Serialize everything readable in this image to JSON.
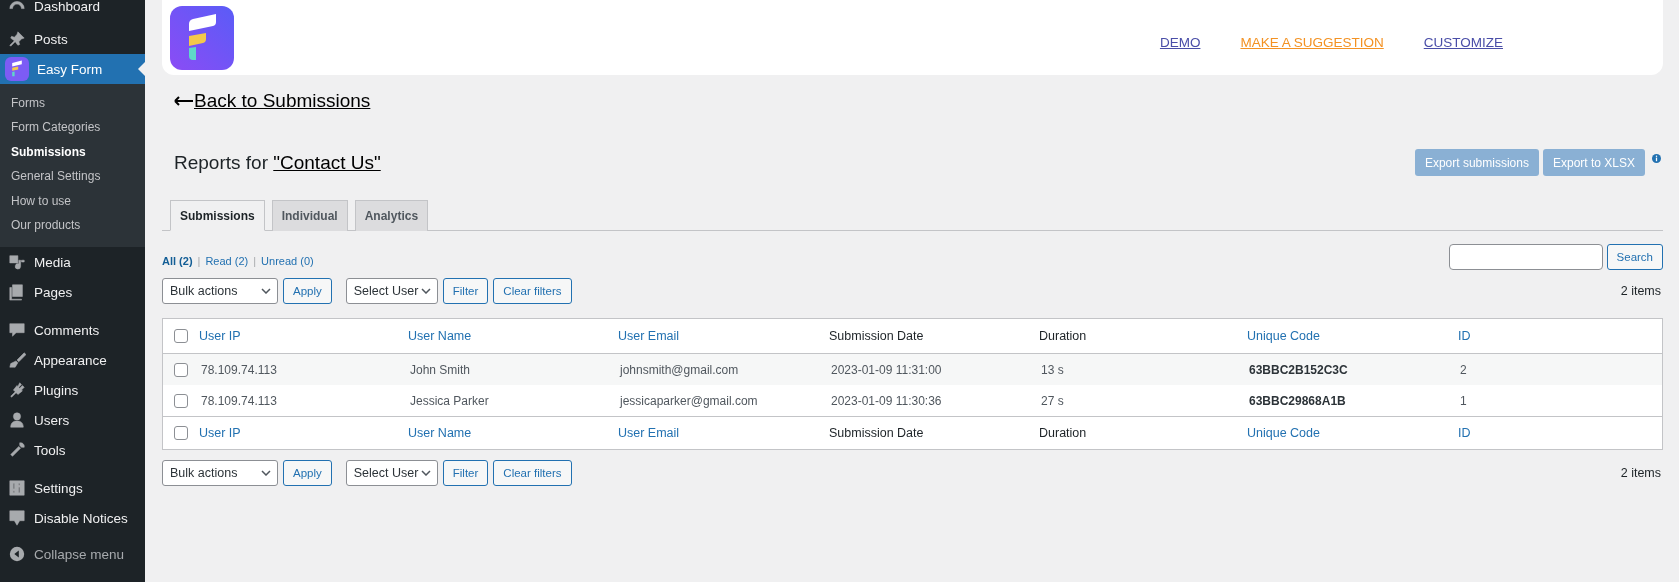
{
  "sidebar": {
    "items": [
      {
        "label": "Dashboard",
        "selected": false
      },
      {
        "label": "Posts",
        "selected": false
      },
      {
        "label": "Easy Form",
        "selected": true,
        "children": [
          {
            "label": "Forms",
            "selected": false
          },
          {
            "label": "Form Categories",
            "selected": false
          },
          {
            "label": "Submissions",
            "selected": true
          },
          {
            "label": "General Settings",
            "selected": false
          },
          {
            "label": "How to use",
            "selected": false
          },
          {
            "label": "Our products",
            "selected": false
          }
        ]
      },
      {
        "label": "Media",
        "selected": false
      },
      {
        "label": "Pages",
        "selected": false
      },
      {
        "label": "Comments",
        "selected": false
      },
      {
        "label": "Appearance",
        "selected": false
      },
      {
        "label": "Plugins",
        "selected": false
      },
      {
        "label": "Users",
        "selected": false
      },
      {
        "label": "Tools",
        "selected": false
      },
      {
        "label": "Settings",
        "selected": false
      },
      {
        "label": "Disable Notices",
        "selected": false
      }
    ],
    "collapse": "Collapse menu"
  },
  "header": {
    "links": [
      {
        "label": "DEMO",
        "color": "#4a4ea8"
      },
      {
        "label": "MAKE A SUGGESTION",
        "color": "#f39223"
      },
      {
        "label": "CUSTOMIZE",
        "color": "#4a4ea8"
      }
    ]
  },
  "back_link": "Back to Submissions",
  "title": {
    "prefix": "Reports for ",
    "form_link": "\"Contact Us\""
  },
  "export_buttons": [
    "Export submissions",
    "Export to XLSX"
  ],
  "tabs": [
    {
      "label": "Submissions",
      "selected": true
    },
    {
      "label": "Individual",
      "selected": false
    },
    {
      "label": "Analytics",
      "selected": false
    }
  ],
  "status_filters": [
    {
      "label": "All (2)",
      "selected": true
    },
    {
      "label": "Read (2)",
      "selected": false,
      "separator": "|"
    },
    {
      "label": "Unread (0)",
      "selected": false,
      "separator": "|"
    }
  ],
  "search": {
    "button": "Search"
  },
  "toolbar": {
    "bulk_actions": "Bulk actions",
    "apply": "Apply",
    "select_user": "Select User",
    "filter": "Filter",
    "clear_filters": "Clear filters",
    "count": "2 items"
  },
  "table": {
    "columns": [
      {
        "label": "User IP",
        "sortable": true
      },
      {
        "label": "User Name",
        "sortable": true
      },
      {
        "label": "User Email",
        "sortable": true
      },
      {
        "label": "Submission Date",
        "sortable": false
      },
      {
        "label": "Duration",
        "sortable": false
      },
      {
        "label": "Unique Code",
        "sortable": true
      },
      {
        "label": "ID",
        "sortable": true
      }
    ],
    "footer_columns": [
      {
        "label": "User IP",
        "sortable": true
      },
      {
        "label": "User Name",
        "sortable": true
      },
      {
        "label": "User Email",
        "sortable": true
      },
      {
        "label": "Submission Date",
        "sortable": false
      },
      {
        "label": "Duration",
        "sortable": false
      },
      {
        "label": "Unique Code",
        "sortable": true
      },
      {
        "label": "ID",
        "sortable": true
      }
    ],
    "header_checked": false,
    "footer_checked": false,
    "rows": [
      {
        "checked": false,
        "cells": [
          "78.109.74.113",
          "John Smith",
          "johnsmith@gmail.com",
          "2023-01-09 11:31:00",
          "13 s",
          "63BBC2B152C3C",
          "2"
        ]
      },
      {
        "checked": false,
        "cells": [
          "78.109.74.113",
          "Jessica Parker",
          "jessicaparker@gmail.com",
          "2023-01-09 11:30:36",
          "27 s",
          "63BBC29868A1B",
          "1"
        ]
      }
    ]
  },
  "bottom_toolbar": {
    "bulk_actions": "Bulk actions",
    "apply": "Apply",
    "select_user": "Select User",
    "filter": "Filter",
    "clear_filters": "Clear filters",
    "count": "2 items"
  }
}
